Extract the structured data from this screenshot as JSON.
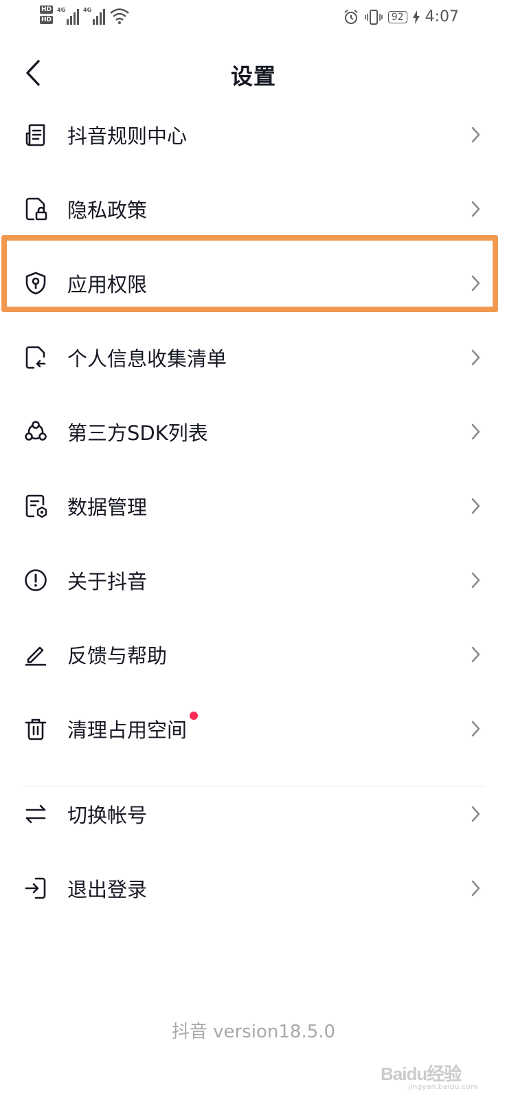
{
  "status_bar": {
    "hd1": "HD",
    "hd2": "HD",
    "net1": "4G",
    "net2": "4G",
    "battery": "92",
    "time": "4:07",
    "icons": [
      "alarm-icon",
      "vibrate-icon",
      "wifi-icon",
      "battery-icon",
      "charging-icon"
    ]
  },
  "header": {
    "title": "设置",
    "back_icon": "chevron-left-icon"
  },
  "menu": [
    {
      "label": "抖音规则中心",
      "icon": "document-list-icon"
    },
    {
      "label": "隐私政策",
      "icon": "privacy-lock-icon"
    },
    {
      "label": "应用权限",
      "icon": "shield-permission-icon",
      "highlighted": true
    },
    {
      "label": "个人信息收集清单",
      "icon": "file-transfer-icon"
    },
    {
      "label": "第三方SDK列表",
      "icon": "sdk-nodes-icon"
    },
    {
      "label": "数据管理",
      "icon": "data-settings-icon"
    },
    {
      "label": "关于抖音",
      "icon": "info-circle-icon"
    },
    {
      "label": "反馈与帮助",
      "icon": "edit-pen-icon"
    },
    {
      "label": "清理占用空间",
      "icon": "trash-icon",
      "badge": "red-dot"
    },
    {
      "label": "切换帐号",
      "icon": "switch-arrows-icon"
    },
    {
      "label": "退出登录",
      "icon": "logout-icon"
    }
  ],
  "footer": {
    "version": "抖音 version18.5.0"
  },
  "watermark": {
    "text": "Baidu经验",
    "sub": "jingyan.baidu.com"
  },
  "colors": {
    "highlight": "#f0994f",
    "badge": "#fe2c55",
    "text": "#161823",
    "muted": "#a8a8ad"
  }
}
